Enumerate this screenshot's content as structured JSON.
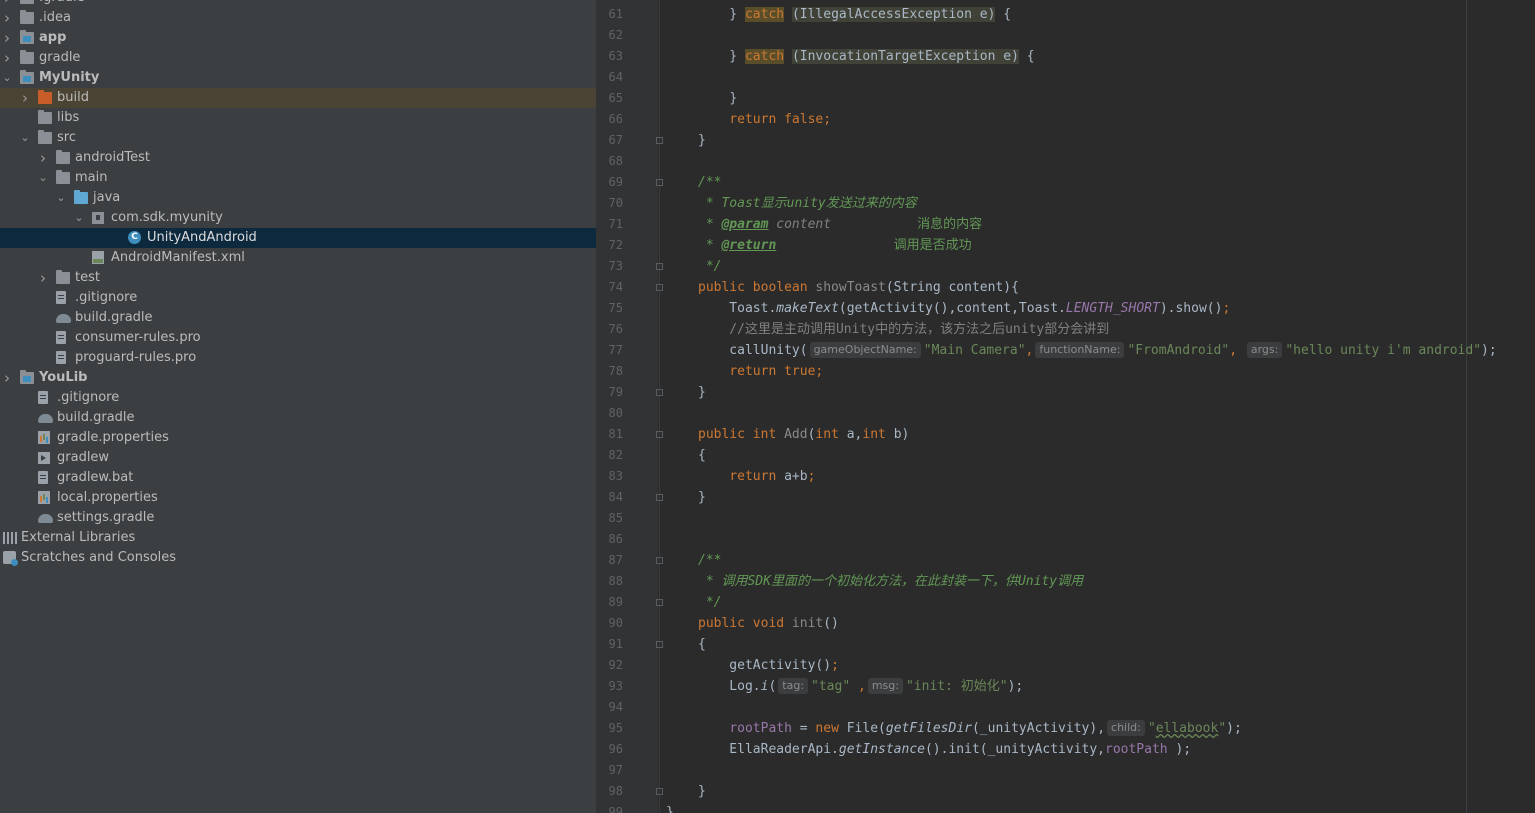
{
  "tree": {
    "items": [
      {
        "label": ".gradle",
        "depth": 0,
        "arrow": "right",
        "icon": "folder-icon"
      },
      {
        "label": ".idea",
        "depth": 0,
        "arrow": "right",
        "icon": "folder-icon"
      },
      {
        "label": "app",
        "depth": 0,
        "arrow": "right",
        "icon": "module-icon",
        "bold": true
      },
      {
        "label": "gradle",
        "depth": 0,
        "arrow": "right",
        "icon": "folder-icon"
      },
      {
        "label": "MyUnity",
        "depth": 0,
        "arrow": "down",
        "icon": "module-icon",
        "bold": true
      },
      {
        "label": "build",
        "depth": 1,
        "arrow": "right",
        "icon": "folder-orange-icon",
        "highlight": true
      },
      {
        "label": "libs",
        "depth": 1,
        "arrow": "",
        "icon": "folder-icon"
      },
      {
        "label": "src",
        "depth": 1,
        "arrow": "down",
        "icon": "folder-icon"
      },
      {
        "label": "androidTest",
        "depth": 2,
        "arrow": "right",
        "icon": "folder-icon"
      },
      {
        "label": "main",
        "depth": 2,
        "arrow": "down",
        "icon": "folder-icon"
      },
      {
        "label": "java",
        "depth": 3,
        "arrow": "down",
        "icon": "folder-blue-icon"
      },
      {
        "label": "com.sdk.myunity",
        "depth": 4,
        "arrow": "down",
        "icon": "package-icon"
      },
      {
        "label": "UnityAndAndroid",
        "depth": 6,
        "arrow": "",
        "icon": "class-icon",
        "selected": true
      },
      {
        "label": "AndroidManifest.xml",
        "depth": 4,
        "arrow": "",
        "icon": "xml-icon"
      },
      {
        "label": "test",
        "depth": 2,
        "arrow": "right",
        "icon": "folder-icon"
      },
      {
        "label": ".gitignore",
        "depth": 2,
        "arrow": "",
        "icon": "gitignore-icon"
      },
      {
        "label": "build.gradle",
        "depth": 2,
        "arrow": "",
        "icon": "gradle-icon"
      },
      {
        "label": "consumer-rules.pro",
        "depth": 2,
        "arrow": "",
        "icon": "file-icon"
      },
      {
        "label": "proguard-rules.pro",
        "depth": 2,
        "arrow": "",
        "icon": "file-icon"
      },
      {
        "label": "YouLib",
        "depth": 0,
        "arrow": "right",
        "icon": "module-icon",
        "bold": true
      },
      {
        "label": ".gitignore",
        "depth": 1,
        "arrow": "",
        "icon": "gitignore-icon"
      },
      {
        "label": "build.gradle",
        "depth": 1,
        "arrow": "",
        "icon": "gradle-icon"
      },
      {
        "label": "gradle.properties",
        "depth": 1,
        "arrow": "",
        "icon": "properties-icon"
      },
      {
        "label": "gradlew",
        "depth": 1,
        "arrow": "",
        "icon": "terminal-icon"
      },
      {
        "label": "gradlew.bat",
        "depth": 1,
        "arrow": "",
        "icon": "file-icon"
      },
      {
        "label": "local.properties",
        "depth": 1,
        "arrow": "",
        "icon": "properties-icon"
      },
      {
        "label": "settings.gradle",
        "depth": 1,
        "arrow": "",
        "icon": "gradle-icon"
      },
      {
        "label": "External Libraries",
        "depth": 0,
        "arrow": "",
        "icon": "libraries-icon",
        "noarrowcol": true
      },
      {
        "label": "Scratches and Consoles",
        "depth": 0,
        "arrow": "",
        "icon": "scratches-icon",
        "noarrowcol": true
      }
    ]
  },
  "editor": {
    "line_numbers": [
      "61",
      "62",
      "63",
      "64",
      "65",
      "66",
      "67",
      "68",
      "69",
      "70",
      "71",
      "72",
      "73",
      "74",
      "75",
      "76",
      "77",
      "78",
      "79",
      "80",
      "81",
      "82",
      "83",
      "84",
      "85",
      "86",
      "87",
      "88",
      "89",
      "90",
      "91",
      "92",
      "93",
      "94",
      "95",
      "96",
      "97",
      "98",
      "99"
    ],
    "fold_lines": [
      "67",
      "69",
      "73",
      "74",
      "79",
      "81",
      "84",
      "87",
      "89",
      "91",
      "98"
    ],
    "code": {
      "l61_catch": "catch",
      "l61_ex": "(IllegalAccessException e)",
      "l63_catch": "catch",
      "l63_ex": "(InvocationTargetException e)",
      "l65": "}",
      "l66_return": "return",
      "l66_false": "false",
      "l67": "}",
      "l69": "/**",
      "l70": " * Toast显示unity发送过来的内容",
      "l71_star": " * ",
      "l71_tag": "@param",
      "l71_name": " content",
      "l71_desc": "           消息的内容",
      "l72_star": " * ",
      "l72_tag": "@return",
      "l72_desc": "               调用是否成功",
      "l73": " */",
      "l74_mod": "public boolean",
      "l74_name": "showToast",
      "l74_params": "(String content){",
      "l75_pre": "    Toast.",
      "l75_m": "makeText",
      "l75_mid": "(getActivity(),content,Toast.",
      "l75_const": "LENGTH_SHORT",
      "l75_post": ").show()",
      "l76": "    //这里是主动调用Unity中的方法，该方法之后unity部分会讲到",
      "l77_call": "    callUnity(",
      "l77_h1": "gameObjectName:",
      "l77_s1": "\"Main Camera\"",
      "l77_h2": "functionName:",
      "l77_s2": "\"FromAndroid\"",
      "l77_h3": "args:",
      "l77_s3": "\"hello unity i'm android\"",
      "l77_end": ");",
      "l78_return": "return",
      "l78_true": "true",
      "l79": "}",
      "l81_mod": "public int",
      "l81_name": "Add",
      "l81_p1": "int",
      "l81_a": " a,",
      "l81_p2": "int",
      "l81_b": " b)",
      "l82": "{",
      "l83_return": "return",
      "l83_expr": " a+b",
      "l84": "}",
      "l87": "/**",
      "l88": " * 调用SDK里面的一个初始化方法，在此封装一下，供Unity调用",
      "l89": " */",
      "l90_mod": "public void",
      "l90_name": "init",
      "l90_params": "()",
      "l91": "{",
      "l92": "    getActivity()",
      "l93_pre": "    Log.",
      "l93_m": "i",
      "l93_h1": "tag:",
      "l93_s1": "\"tag\"",
      "l93_h2": "msg:",
      "l93_s2": "\"init: 初始化\"",
      "l93_end": ");",
      "l95_field": "rootPath",
      "l95_eq": " = ",
      "l95_new": "new",
      "l95_file": " File(",
      "l95_m": "getFilesDir",
      "l95_arg": "(_unityActivity),",
      "l95_h": "child:",
      "l95_s_pre": "\"",
      "l95_s": "ellabook",
      "l95_s_post": "\"",
      "l95_end": ");",
      "l96_pre": "    EllaReaderApi.",
      "l96_m": "getInstance",
      "l96_mid": "().init(_unityActivity,",
      "l96_field": "rootPath",
      "l96_end": " );",
      "l98": "}",
      "l99": "}"
    }
  },
  "colors": {
    "tree_bg": "#3c3f41",
    "editor_bg": "#2b2b2b",
    "keyword": "#cc7832",
    "string": "#6a8759",
    "doc_comment": "#629755",
    "selection": "#0d293e"
  }
}
